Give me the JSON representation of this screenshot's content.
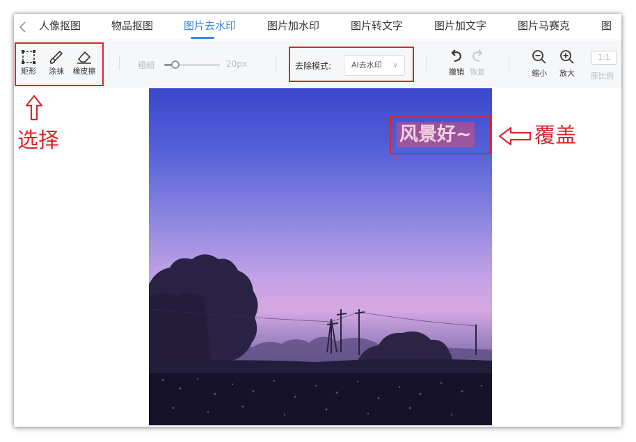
{
  "tabs": [
    {
      "label": "人像抠图",
      "active": false
    },
    {
      "label": "物品抠图",
      "active": false
    },
    {
      "label": "图片去水印",
      "active": true
    },
    {
      "label": "图片加水印",
      "active": false
    },
    {
      "label": "图片转文字",
      "active": false
    },
    {
      "label": "图片加文字",
      "active": false
    },
    {
      "label": "图片马赛克",
      "active": false
    },
    {
      "label": "图",
      "active": false
    }
  ],
  "toolbar": {
    "tools": [
      {
        "label": "矩形",
        "icon": "rectangle-select-icon"
      },
      {
        "label": "涂抹",
        "icon": "brush-icon"
      },
      {
        "label": "橡皮擦",
        "icon": "eraser-icon"
      }
    ],
    "size_label": "粗细",
    "size_value": "20px",
    "size_fraction": 0.15,
    "mode_label": "去除模式:",
    "mode_value": "AI去水印",
    "undo_label": "撤销",
    "redo_label": "恢复",
    "zoom_out_label": "缩小",
    "zoom_in_label": "放大",
    "ratio_value": "1:1",
    "ratio_label": "原比例"
  },
  "watermark_text": "风景好~",
  "annotations": {
    "select_text": "选择",
    "cover_text": "覆盖"
  },
  "colors": {
    "accent": "#3a86e8",
    "annotation_red": "#d8262a"
  }
}
